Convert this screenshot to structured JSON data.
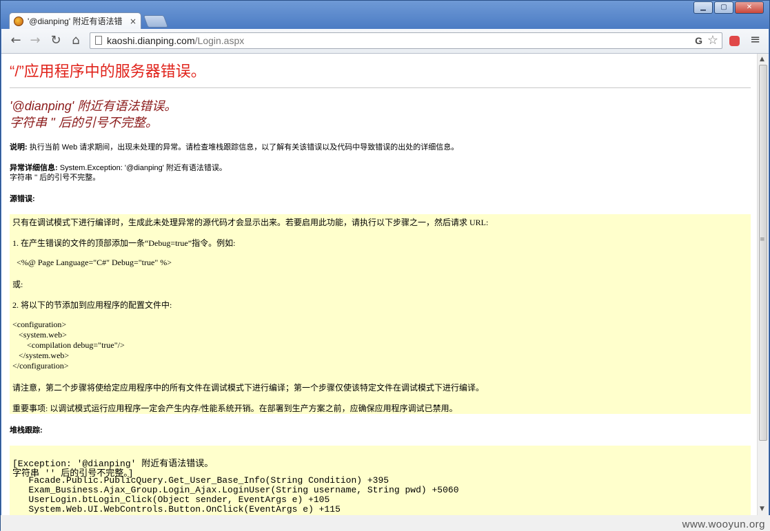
{
  "window": {
    "controls": {
      "minimize": "▁",
      "maximize": "▢",
      "close": "✕"
    }
  },
  "tab": {
    "title": "'@dianping' 附近有语法错",
    "close": "×",
    "favicon": "globe-icon"
  },
  "toolbar": {
    "back": "←",
    "forward": "→",
    "reload": "↻",
    "home": "⌂",
    "url_host": "kaoshi.dianping.com",
    "url_path": "/Login.aspx",
    "g_icon": "G",
    "star": "☆",
    "menu": "≡"
  },
  "page": {
    "title": "“/”应用程序中的服务器错误。",
    "error_line1": "'@dianping' 附近有语法错误。",
    "error_line2": "字符串 '' 后的引号不完整。",
    "description_label": "说明:",
    "description_text": " 执行当前 Web 请求期间，出现未处理的异常。请检查堆栈跟踪信息，以了解有关该错误以及代码中导致错误的出处的详细信息。",
    "exception_label": "异常详细信息:",
    "exception_text": " System.Exception: '@dianping' 附近有语法错误。",
    "exception_text2": "字符串 '' 后的引号不完整。",
    "source_error_label": "源错误:",
    "source_lines": [
      "只有在调试模式下进行编译时，生成此未处理异常的源代码才会显示出来。若要启用此功能，请执行以下步骤之一，然后请求 URL:",
      "1. 在产生错误的文件的顶部添加一条“Debug=true”指令。例如:",
      "  <%@ Page Language=\"C#\" Debug=\"true\" %>",
      "或:",
      "2. 将以下的节添加到应用程序的配置文件中:",
      "<configuration>",
      "   <system.web>",
      "       <compilation debug=\"true\"/>",
      "   </system.web>",
      "</configuration>",
      "请注意，第二个步骤将使给定应用程序中的所有文件在调试模式下进行编译；第一个步骤仅使该特定文件在调试模式下进行编译。",
      "重要事项: 以调试模式运行应用程序一定会产生内存/性能系统开销。在部署到生产方案之前，应确保应用程序调试已禁用。"
    ],
    "stack_label": "堆栈跟踪:",
    "stack_lines": [
      "[Exception: '@dianping' 附近有语法错误。",
      "字符串 '' 后的引号不完整。]",
      "   Facade.Public.PublicQuery.Get_User_Base_Info(String Condition) +395",
      "   Exam_Business.Ajax_Group.Login_Ajax.LoginUser(String username, String pwd) +5060",
      "   UserLogin.btLogin_Click(Object sender, EventArgs e) +105",
      "   System.Web.UI.WebControls.Button.OnClick(EventArgs e) +115"
    ]
  },
  "watermark": "www.wooyun.org"
}
